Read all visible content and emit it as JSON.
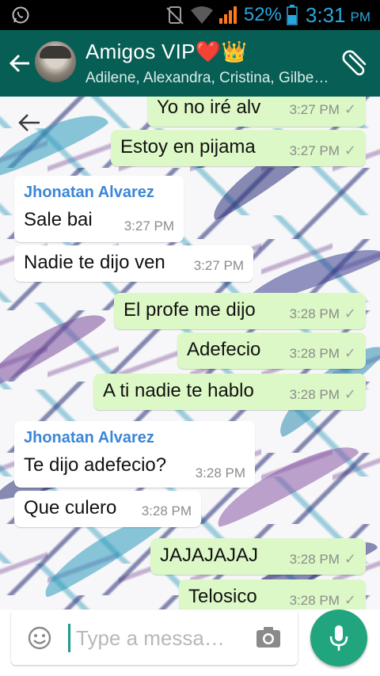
{
  "status_bar": {
    "battery_percent": "52%",
    "time": "3:31",
    "ampm": "PM",
    "icons": [
      "whatsapp-icon",
      "no-sim-icon",
      "wifi-icon",
      "signal-icon",
      "battery-icon"
    ]
  },
  "header": {
    "title_text": "Amigos VIP",
    "title_heart": "❤️",
    "title_crown": "👑",
    "subtitle": "Adilene, Alexandra, Cristina, Gilbe…"
  },
  "messages": [
    {
      "direction": "out",
      "text": "Yo no iré alv",
      "time": "3:27 PM"
    },
    {
      "direction": "out",
      "text": "Estoy en pijama",
      "time": "3:27 PM"
    },
    {
      "direction": "in",
      "sender": "Jhonatan Alvarez",
      "text": "Sale bai",
      "time": "3:27 PM"
    },
    {
      "direction": "in",
      "text": "Nadie te dijo ven",
      "time": "3:27 PM"
    },
    {
      "direction": "out",
      "text": "El profe me dijo",
      "time": "3:28 PM"
    },
    {
      "direction": "out",
      "text": "Adefecio",
      "time": "3:28 PM"
    },
    {
      "direction": "out",
      "text": "A ti nadie te hablo",
      "time": "3:28 PM"
    },
    {
      "direction": "in",
      "sender": "Jhonatan Alvarez",
      "text": "Te dijo adefecio?",
      "time": "3:28 PM"
    },
    {
      "direction": "in",
      "text": "Que culero",
      "time": "3:28 PM"
    },
    {
      "direction": "out",
      "text": "JAJAJAJAJ",
      "time": "3:28 PM"
    },
    {
      "direction": "out",
      "text": "Telosico",
      "time": "3:28 PM"
    }
  ],
  "tick": "✓",
  "input": {
    "placeholder": "Type a messa…"
  },
  "colors": {
    "app_bar": "#075e54",
    "outgoing_bubble": "#dcf8c6",
    "incoming_bubble": "#ffffff",
    "sender_name": "#3b86d6",
    "mic_button": "#21a57e",
    "status_text": "#2aa6de"
  }
}
